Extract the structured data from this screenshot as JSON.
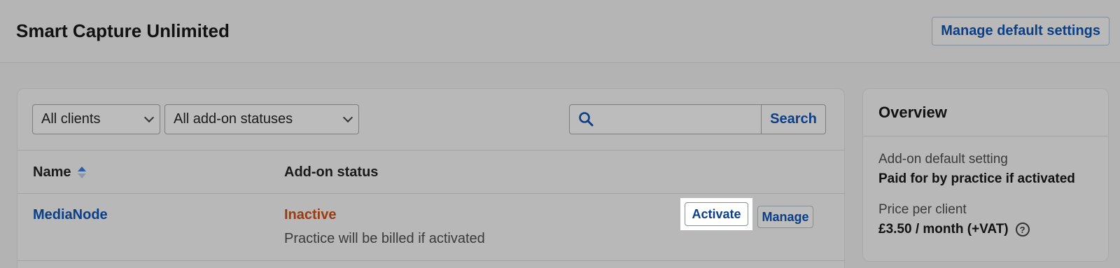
{
  "header": {
    "title": "Smart Capture Unlimited",
    "manage_defaults_label": "Manage default settings"
  },
  "filters": {
    "clients_select": "All clients",
    "status_select": "All add-on statuses",
    "search_value": "",
    "search_button": "Search",
    "search_icon": "search-icon"
  },
  "table": {
    "columns": [
      "Name",
      "Add-on status"
    ],
    "rows": [
      {
        "name": "MediaNode",
        "status": "Inactive",
        "status_note": "Practice will be billed if activated",
        "activate_label": "Activate",
        "manage_label": "Manage"
      }
    ]
  },
  "overview": {
    "title": "Overview",
    "default_setting_label": "Add-on default setting",
    "default_setting_value": "Paid for by practice if activated",
    "price_label": "Price per client",
    "price_value": "£3.50 / month (+VAT)",
    "help_icon_glyph": "?"
  },
  "colors": {
    "link": "#0b3f86",
    "inactive": "#9a3c10",
    "overlay_bg": "#b3b3b3"
  }
}
